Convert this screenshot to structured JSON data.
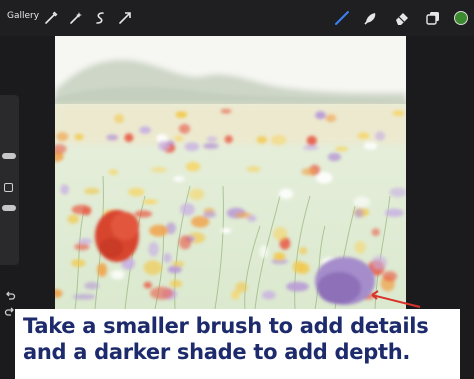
{
  "topbar": {
    "gallery_label": "Gallery",
    "left_tools": [
      {
        "name": "adjustments-icon"
      },
      {
        "name": "selection-icon"
      },
      {
        "name": "transform-icon"
      },
      {
        "name": "actions-icon"
      }
    ],
    "right_tools": [
      {
        "name": "brush-icon",
        "active": true
      },
      {
        "name": "smudge-icon"
      },
      {
        "name": "eraser-icon"
      },
      {
        "name": "layers-icon"
      }
    ],
    "active_color": "#3c8a2e",
    "accent_color": "#3b82f6"
  },
  "sidebar": {
    "brush_size_slider": "brush-size",
    "opacity_slider": "opacity"
  },
  "canvas": {
    "subject": "wildflower-meadow-painting"
  },
  "caption": {
    "line1": "Take a smaller brush to add details",
    "line2": "and a darker shade to add depth.",
    "text_color": "#1d2a6b"
  },
  "annotation": {
    "arrow_color": "#d9342b"
  }
}
